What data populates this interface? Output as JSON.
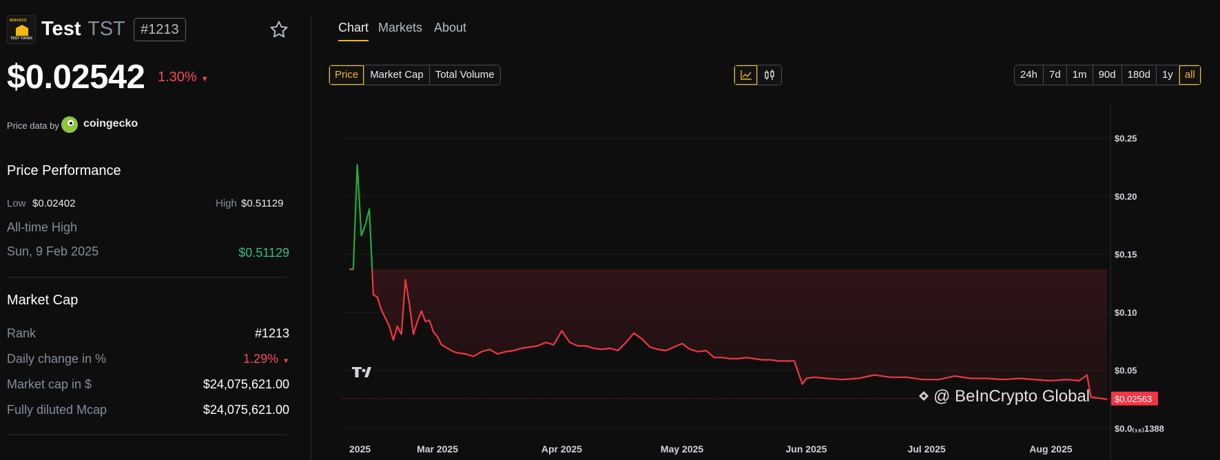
{
  "token": {
    "logo_top_text": "BINANCE",
    "logo_bottom_text": "TEST TOKEN",
    "name": "Test",
    "symbol": "TST",
    "rank_badge": "#1213",
    "price": "$0.02542",
    "change": "1.30%",
    "change_arrow": "▼",
    "price_data_by": "Price data by",
    "data_source": "coingecko"
  },
  "performance": {
    "title": "Price Performance",
    "low_label": "Low",
    "low_value": "$0.02402",
    "high_label": "High",
    "high_value": "$0.51129",
    "ath_label": "All-time High",
    "ath_date": "Sun, 9 Feb 2025",
    "ath_value": "$0.51129"
  },
  "market_cap": {
    "title": "Market Cap",
    "rows": [
      {
        "label": "Rank",
        "value": "#1213"
      },
      {
        "label": "Daily change in %",
        "value": "1.29%",
        "arrow": "▼"
      },
      {
        "label": "Market cap in $",
        "value": "$24,075,621.00"
      },
      {
        "label": "Fully diluted Mcap",
        "value": "$24,075,621.00"
      }
    ]
  },
  "tabs": [
    "Chart",
    "Markets",
    "About"
  ],
  "metric_buttons": [
    "Price",
    "Market Cap",
    "Total Volume"
  ],
  "chart_type_icons": [
    "line-chart-icon",
    "candlestick-icon"
  ],
  "ranges": [
    "24h",
    "7d",
    "1m",
    "90d",
    "180d",
    "1y",
    "all"
  ],
  "selected_metric": "Price",
  "selected_range": "all",
  "watermark": "@ BeInCrypto Global",
  "colors": {
    "accent": "#f0b90b",
    "up": "#2ebd85",
    "down": "#f6465d",
    "line_down": "#f23645",
    "line_up": "#22ab3c"
  },
  "chart_data": {
    "type": "line",
    "x_labels": [
      "2025",
      "Mar 2025",
      "Apr 2025",
      "May 2025",
      "Jun 2025",
      "Jul 2025",
      "Aug 2025"
    ],
    "y_ticks": [
      "$0.25",
      "$0.20",
      "$0.15",
      "$0.10",
      "$0.05",
      "$0.0₍₁₆₎1388"
    ],
    "ylim": [
      0,
      0.28
    ],
    "baseline": 0.137,
    "current_label": "$0.02563",
    "current_value": 0.02563,
    "series": [
      {
        "x": [
          "2025-02-07",
          "2025-02-08",
          "2025-02-09",
          "2025-02-10",
          "2025-02-11",
          "2025-02-12",
          "2025-02-13",
          "2025-02-14",
          "2025-02-15",
          "2025-02-16",
          "2025-02-17",
          "2025-02-18",
          "2025-02-19",
          "2025-02-20",
          "2025-02-21",
          "2025-02-22",
          "2025-02-23",
          "2025-02-24",
          "2025-02-25",
          "2025-02-26",
          "2025-02-27",
          "2025-02-28",
          "2025-03-01",
          "2025-03-02",
          "2025-03-03",
          "2025-03-04",
          "2025-03-05",
          "2025-03-06",
          "2025-03-08",
          "2025-03-10",
          "2025-03-12",
          "2025-03-14",
          "2025-03-16",
          "2025-03-18",
          "2025-03-20",
          "2025-03-22",
          "2025-03-24",
          "2025-03-26",
          "2025-03-28",
          "2025-03-30",
          "2025-04-01",
          "2025-04-03",
          "2025-04-05",
          "2025-04-07",
          "2025-04-09",
          "2025-04-11",
          "2025-04-13",
          "2025-04-15",
          "2025-04-17",
          "2025-04-19",
          "2025-04-21",
          "2025-04-23",
          "2025-04-25",
          "2025-04-27",
          "2025-04-29",
          "2025-05-01",
          "2025-05-03",
          "2025-05-05",
          "2025-05-07",
          "2025-05-09",
          "2025-05-11",
          "2025-05-13",
          "2025-05-15",
          "2025-05-17",
          "2025-05-19",
          "2025-05-21",
          "2025-05-23",
          "2025-05-25",
          "2025-05-27",
          "2025-05-29",
          "2025-05-31",
          "2025-06-01",
          "2025-06-03",
          "2025-06-06",
          "2025-06-10",
          "2025-06-14",
          "2025-06-18",
          "2025-06-22",
          "2025-06-26",
          "2025-06-30",
          "2025-07-04",
          "2025-07-08",
          "2025-07-12",
          "2025-07-16",
          "2025-07-20",
          "2025-07-24",
          "2025-07-28",
          "2025-08-01",
          "2025-08-05",
          "2025-08-08",
          "2025-08-10",
          "2025-08-11",
          "2025-08-13",
          "2025-08-15"
        ],
        "values": [
          0.137,
          0.137,
          0.227,
          0.166,
          0.175,
          0.189,
          0.115,
          0.113,
          0.102,
          0.095,
          0.088,
          0.076,
          0.088,
          0.081,
          0.128,
          0.107,
          0.081,
          0.092,
          0.101,
          0.092,
          0.093,
          0.083,
          0.079,
          0.072,
          0.07,
          0.068,
          0.066,
          0.065,
          0.064,
          0.062,
          0.066,
          0.068,
          0.064,
          0.066,
          0.067,
          0.069,
          0.07,
          0.071,
          0.074,
          0.072,
          0.084,
          0.074,
          0.071,
          0.071,
          0.069,
          0.068,
          0.069,
          0.067,
          0.074,
          0.082,
          0.077,
          0.07,
          0.068,
          0.067,
          0.07,
          0.073,
          0.068,
          0.066,
          0.067,
          0.061,
          0.061,
          0.06,
          0.06,
          0.061,
          0.06,
          0.059,
          0.059,
          0.058,
          0.058,
          0.058,
          0.038,
          0.043,
          0.044,
          0.043,
          0.042,
          0.043,
          0.046,
          0.044,
          0.044,
          0.042,
          0.042,
          0.045,
          0.043,
          0.043,
          0.042,
          0.043,
          0.042,
          0.041,
          0.042,
          0.041,
          0.046,
          0.027,
          0.026,
          0.025
        ]
      }
    ]
  }
}
